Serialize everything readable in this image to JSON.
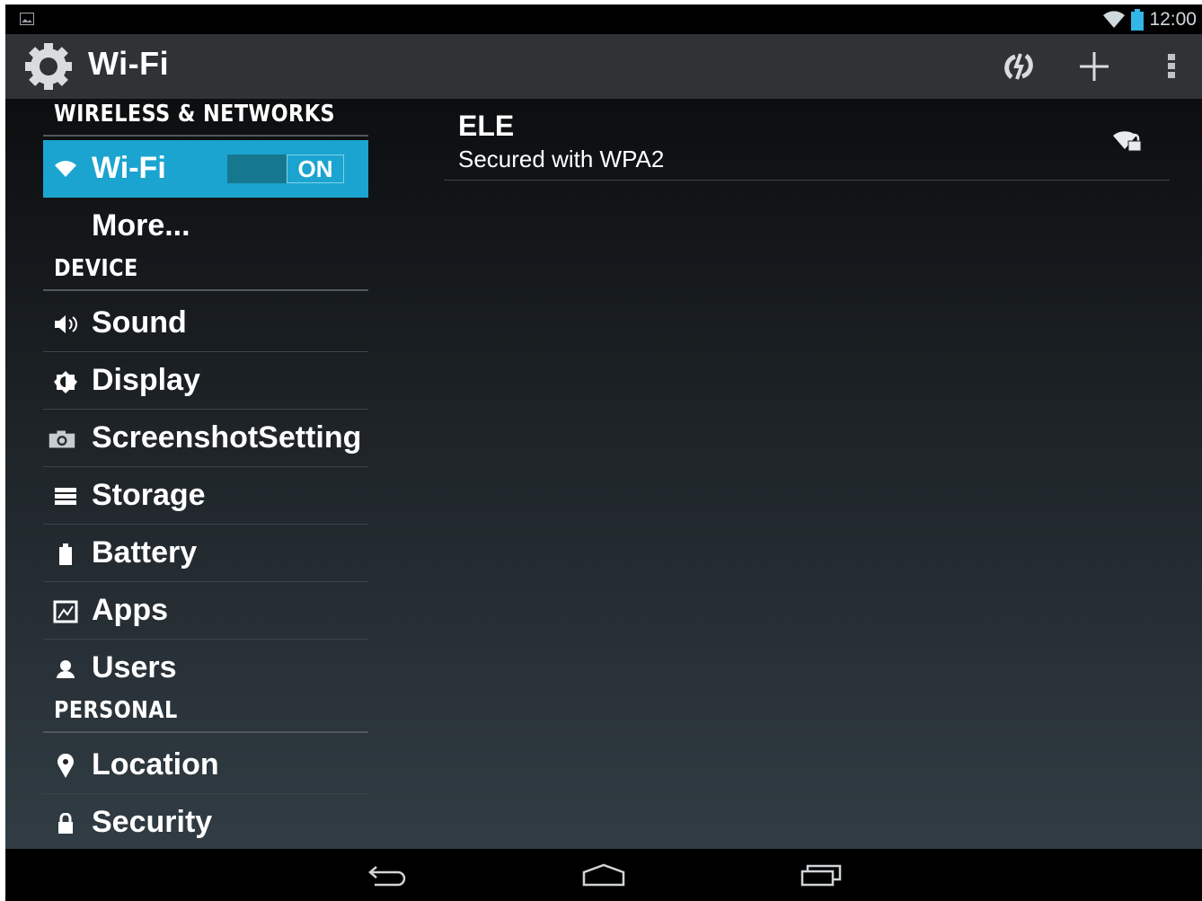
{
  "status_bar": {
    "time": "12:00",
    "icons": [
      "picture-notification-icon",
      "wifi-signal-icon",
      "battery-icon"
    ]
  },
  "action_bar": {
    "title": "Wi-Fi",
    "app_icon": "settings-gear-icon",
    "actions": [
      "wps-push-button-icon",
      "add-network-icon",
      "overflow-menu-icon"
    ]
  },
  "sidebar": {
    "sections": {
      "wireless": "WIRELESS & NETWORKS",
      "device": "DEVICE",
      "personal": "PERSONAL"
    },
    "items": {
      "wifi": {
        "label": "Wi-Fi",
        "icon": "wifi-icon",
        "toggle": "ON"
      },
      "more": {
        "label": "More..."
      },
      "sound": {
        "label": "Sound",
        "icon": "speaker-icon"
      },
      "display": {
        "label": "Display",
        "icon": "brightness-icon"
      },
      "screenshot": {
        "label": "ScreenshotSetting",
        "icon": "camera-icon"
      },
      "storage": {
        "label": "Storage",
        "icon": "storage-icon"
      },
      "battery": {
        "label": "Battery",
        "icon": "battery-icon"
      },
      "apps": {
        "label": "Apps",
        "icon": "apps-icon"
      },
      "users": {
        "label": "Users",
        "icon": "user-icon"
      },
      "location": {
        "label": "Location",
        "icon": "location-pin-icon"
      },
      "security": {
        "label": "Security",
        "icon": "lock-icon"
      }
    }
  },
  "networks": [
    {
      "ssid": "ELE",
      "security": "Secured with WPA2",
      "icon": "wifi-locked-signal-icon"
    }
  ],
  "nav_bar": {
    "buttons": [
      "back-icon",
      "home-icon",
      "recents-icon"
    ]
  },
  "colors": {
    "accent": "#1ba4cf",
    "action_bar": "#2f3336",
    "background_top": "#0c0e10",
    "background_bottom": "#313c44"
  }
}
